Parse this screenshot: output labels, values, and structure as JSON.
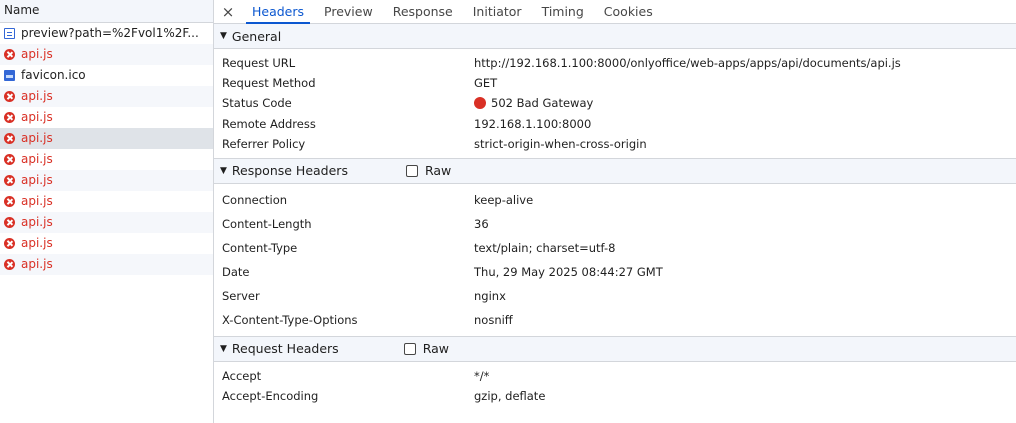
{
  "requests_panel": {
    "header": "Name",
    "rows": [
      {
        "name": "preview?path=%2Fvol1%2F...",
        "status": "doc"
      },
      {
        "name": "api.js",
        "status": "error"
      },
      {
        "name": "favicon.ico",
        "status": "image"
      },
      {
        "name": "api.js",
        "status": "error"
      },
      {
        "name": "api.js",
        "status": "error"
      },
      {
        "name": "api.js",
        "status": "error"
      },
      {
        "name": "api.js",
        "status": "error"
      },
      {
        "name": "api.js",
        "status": "error"
      },
      {
        "name": "api.js",
        "status": "error"
      },
      {
        "name": "api.js",
        "status": "error"
      },
      {
        "name": "api.js",
        "status": "error"
      },
      {
        "name": "api.js",
        "status": "error"
      }
    ]
  },
  "tabs": {
    "close_icon": "×",
    "items": [
      "Headers",
      "Preview",
      "Response",
      "Initiator",
      "Timing",
      "Cookies"
    ],
    "active": "Headers"
  },
  "general": {
    "title": "General",
    "rows": [
      {
        "key": "Request URL",
        "value": "http://192.168.1.100:8000/onlyoffice/web-apps/apps/api/documents/api.js"
      },
      {
        "key": "Request Method",
        "value": "GET"
      },
      {
        "key": "Status Code",
        "value": "502 Bad Gateway"
      },
      {
        "key": "Remote Address",
        "value": "192.168.1.100:8000"
      },
      {
        "key": "Referrer Policy",
        "value": "strict-origin-when-cross-origin"
      }
    ]
  },
  "response_headers": {
    "title": "Response Headers",
    "raw_label": "Raw",
    "rows": [
      {
        "key": "Connection",
        "value": "keep-alive"
      },
      {
        "key": "Content-Length",
        "value": "36"
      },
      {
        "key": "Content-Type",
        "value": "text/plain; charset=utf-8"
      },
      {
        "key": "Date",
        "value": "Thu, 29 May 2025 08:44:27 GMT"
      },
      {
        "key": "Server",
        "value": "nginx"
      },
      {
        "key": "X-Content-Type-Options",
        "value": "nosniff"
      }
    ]
  },
  "request_headers": {
    "title": "Request Headers",
    "raw_label": "Raw",
    "rows": [
      {
        "key": "Accept",
        "value": "*/*"
      },
      {
        "key": "Accept-Encoding",
        "value": "gzip, deflate"
      }
    ]
  },
  "colors": {
    "accent": "#0b57d0",
    "error": "#d93025"
  },
  "icons": {
    "doc": "document-icon",
    "error": "error-icon",
    "image": "image-icon",
    "status": "status-dot-icon",
    "collapse": "triangle-down-icon"
  }
}
